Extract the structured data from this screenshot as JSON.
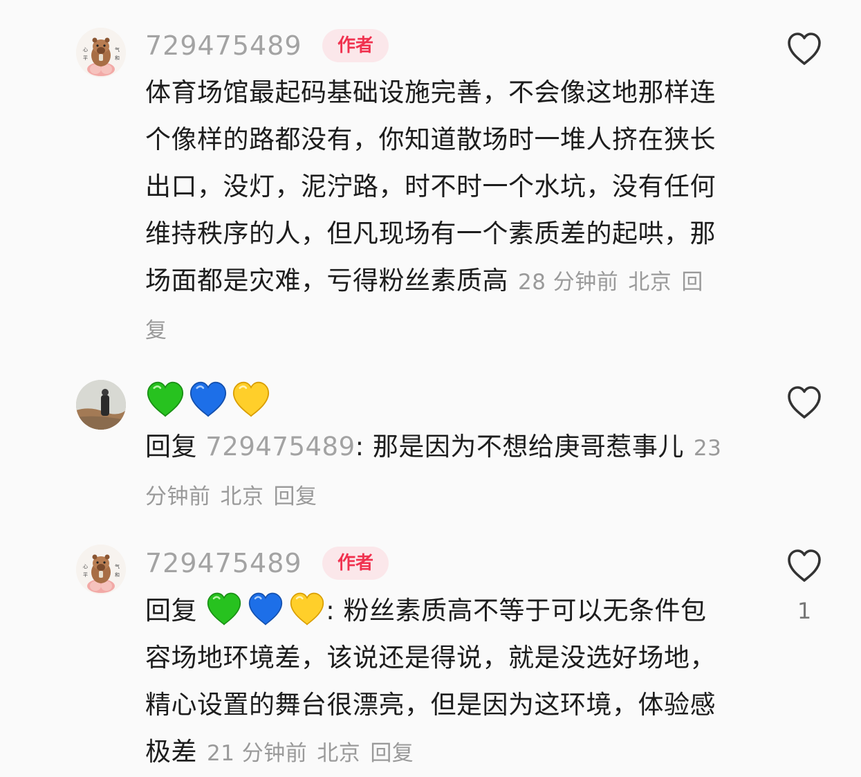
{
  "comments": [
    {
      "username": "729475489",
      "author_badge": "作者",
      "text": "体育场馆最起码基础设施完善，不会像这地那样连个像样的路都没有，你知道散场时一堆人挤在狭长出口，没灯，泥泞路，时不时一个水坑，没有任何维持秩序的人，但凡现场有一个素质差的起哄，那场面都是灾难，亏得粉丝素质高",
      "time": "28 分钟前",
      "location": "北京",
      "reply_label": "回复"
    },
    {
      "emoji_name": [
        "green-heart",
        "blue-heart",
        "yellow-heart"
      ],
      "reply_prefix": "回复",
      "reply_to": "729475489",
      "separator": ": ",
      "text": "那是因为不想给庚哥惹事儿",
      "time": "23 分钟前",
      "location": "北京",
      "reply_label": "回复"
    },
    {
      "username": "729475489",
      "author_badge": "作者",
      "reply_prefix": "回复",
      "separator": ": ",
      "text": "粉丝素质高不等于可以无条件包容场地环境差，该说还是得说，就是没选好场地，精心设置的舞台很漂亮，但是因为这环境，体验感极差",
      "time": "21 分钟前",
      "location": "北京",
      "reply_label": "回复",
      "like_count": "1"
    }
  ],
  "colors": {
    "accent": "#f0324f",
    "badge_bg": "#fbe7ea",
    "muted": "#a3a3a3",
    "text": "#1d1d1d"
  }
}
